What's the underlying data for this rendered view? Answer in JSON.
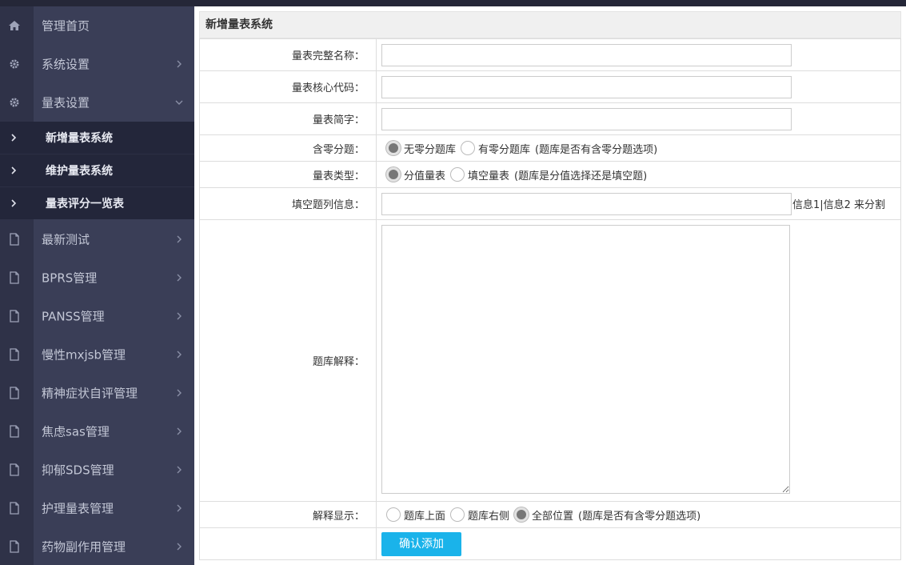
{
  "sidebar": {
    "items": [
      {
        "label": "管理首页",
        "icon": "home-icon"
      },
      {
        "label": "系统设置",
        "icon": "gear-icon"
      },
      {
        "label": "量表设置",
        "icon": "gear-icon"
      },
      {
        "label": "最新测试",
        "icon": "file-icon"
      },
      {
        "label": "BPRS管理",
        "icon": "file-icon"
      },
      {
        "label": "PANSS管理",
        "icon": "file-icon"
      },
      {
        "label": "慢性mxjsb管理",
        "icon": "file-icon"
      },
      {
        "label": "精神症状自评管理",
        "icon": "file-icon"
      },
      {
        "label": "焦虑sas管理",
        "icon": "file-icon"
      },
      {
        "label": "抑郁SDS管理",
        "icon": "file-icon"
      },
      {
        "label": "护理量表管理",
        "icon": "file-icon"
      },
      {
        "label": "药物副作用管理",
        "icon": "file-icon"
      }
    ],
    "subitems": [
      {
        "label": "新增量表系统"
      },
      {
        "label": "维护量表系统"
      },
      {
        "label": "量表评分一览表"
      }
    ]
  },
  "form": {
    "title": "新增量表系统",
    "fields": {
      "full_name": {
        "label": "量表完整名称：",
        "value": ""
      },
      "core_code": {
        "label": "量表核心代码：",
        "value": ""
      },
      "short_name": {
        "label": "量表简字：",
        "value": ""
      },
      "zero_sub": {
        "label": "含零分题：",
        "options": [
          "无零分题库",
          "有零分题库"
        ],
        "selected": "无零分题库",
        "hint": "(题库是否有含零分题选项)"
      },
      "scale_type": {
        "label": "量表类型：",
        "options": [
          "分值量表",
          "填空量表"
        ],
        "selected": "分值量表",
        "hint": "(题库是分值选择还是填空题)"
      },
      "fill_columns": {
        "label": "填空题列信息：",
        "value": "",
        "hint": "信息1|信息2 来分割"
      },
      "explanation": {
        "label": "题库解释：",
        "value": ""
      },
      "explain_display": {
        "label": "解释显示：",
        "options": [
          "题库上面",
          "题库右侧",
          "全部位置"
        ],
        "selected": "全部位置",
        "hint": "(题库是否有含零分题选项)"
      }
    },
    "submit_label": "确认添加"
  },
  "colors": {
    "sidebar_bg": "#3a3e57",
    "sidebar_icon_col": "#2f3248",
    "submenu_bg": "#23263a",
    "button_bg": "#1ab3ea"
  }
}
